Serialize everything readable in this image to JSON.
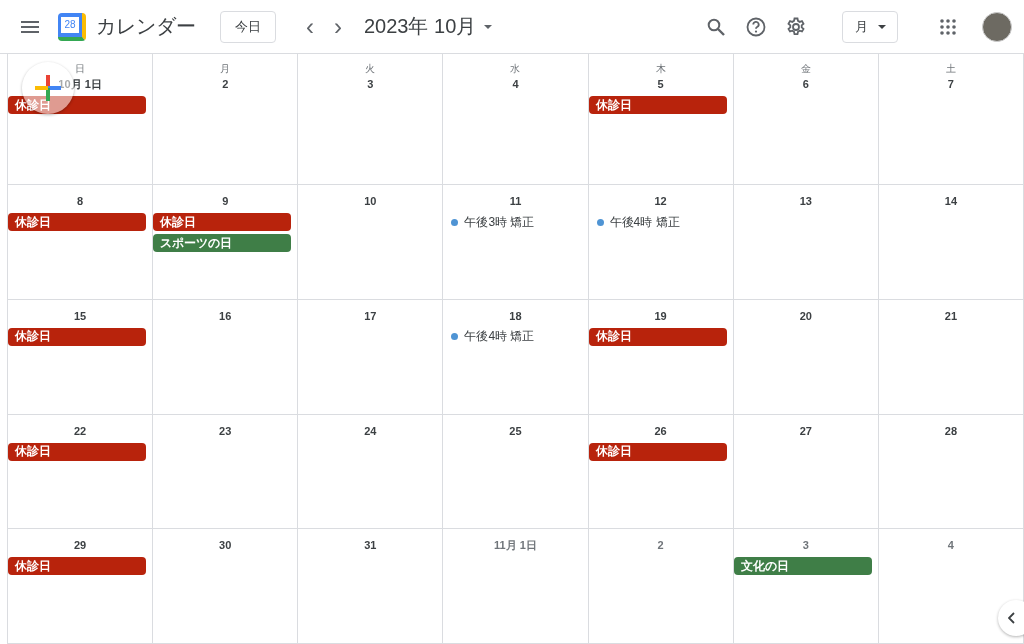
{
  "header": {
    "app_name": "カレンダー",
    "logo_day": "28",
    "today_button": "今日",
    "prev": "‹",
    "next": "›",
    "period": "2023年 10月",
    "view_button": "月"
  },
  "weekdays": [
    "日",
    "月",
    "火",
    "水",
    "木",
    "金",
    "土"
  ],
  "weeks": [
    {
      "days": [
        {
          "date": "10月 1日",
          "muted": false,
          "events": [
            {
              "kind": "allday",
              "title": "休診日",
              "color": "#b8230c"
            }
          ]
        },
        {
          "date": "2",
          "muted": false
        },
        {
          "date": "3",
          "muted": false
        },
        {
          "date": "4",
          "muted": false
        },
        {
          "date": "5",
          "muted": false,
          "events": [
            {
              "kind": "allday",
              "title": "休診日",
              "color": "#b8230c"
            }
          ]
        },
        {
          "date": "6",
          "muted": false
        },
        {
          "date": "7",
          "muted": false
        }
      ]
    },
    {
      "days": [
        {
          "date": "8",
          "muted": false,
          "events": [
            {
              "kind": "allday",
              "title": "休診日",
              "color": "#b8230c"
            }
          ]
        },
        {
          "date": "9",
          "muted": false,
          "events": [
            {
              "kind": "allday",
              "title": "休診日",
              "color": "#b8230c"
            },
            {
              "kind": "allday",
              "title": "スポーツの日",
              "color": "#3f7e47"
            }
          ]
        },
        {
          "date": "10",
          "muted": false
        },
        {
          "date": "11",
          "muted": false,
          "events": [
            {
              "kind": "timed",
              "title": "午後3時 矯正",
              "color": "#4f94d4"
            }
          ]
        },
        {
          "date": "12",
          "muted": false,
          "events": [
            {
              "kind": "timed",
              "title": "午後4時 矯正",
              "color": "#4f94d4"
            }
          ]
        },
        {
          "date": "13",
          "muted": false
        },
        {
          "date": "14",
          "muted": false
        }
      ]
    },
    {
      "days": [
        {
          "date": "15",
          "muted": false,
          "events": [
            {
              "kind": "allday",
              "title": "休診日",
              "color": "#b8230c"
            }
          ]
        },
        {
          "date": "16",
          "muted": false
        },
        {
          "date": "17",
          "muted": false
        },
        {
          "date": "18",
          "muted": false,
          "events": [
            {
              "kind": "timed",
              "title": "午後4時 矯正",
              "color": "#4f94d4"
            }
          ]
        },
        {
          "date": "19",
          "muted": false,
          "events": [
            {
              "kind": "allday",
              "title": "休診日",
              "color": "#b8230c"
            }
          ]
        },
        {
          "date": "20",
          "muted": false
        },
        {
          "date": "21",
          "muted": false
        }
      ]
    },
    {
      "days": [
        {
          "date": "22",
          "muted": false,
          "events": [
            {
              "kind": "allday",
              "title": "休診日",
              "color": "#b8230c"
            }
          ]
        },
        {
          "date": "23",
          "muted": false
        },
        {
          "date": "24",
          "muted": false
        },
        {
          "date": "25",
          "muted": false
        },
        {
          "date": "26",
          "muted": false,
          "events": [
            {
              "kind": "allday",
              "title": "休診日",
              "color": "#b8230c"
            }
          ]
        },
        {
          "date": "27",
          "muted": false
        },
        {
          "date": "28",
          "muted": false
        }
      ]
    },
    {
      "days": [
        {
          "date": "29",
          "muted": false,
          "events": [
            {
              "kind": "allday",
              "title": "休診日",
              "color": "#b8230c"
            }
          ]
        },
        {
          "date": "30",
          "muted": false
        },
        {
          "date": "31",
          "muted": false
        },
        {
          "date": "11月 1日",
          "muted": true
        },
        {
          "date": "2",
          "muted": true
        },
        {
          "date": "3",
          "muted": true,
          "events": [
            {
              "kind": "allday",
              "title": "文化の日",
              "color": "#3f7e47"
            }
          ]
        },
        {
          "date": "4",
          "muted": true
        }
      ]
    }
  ]
}
